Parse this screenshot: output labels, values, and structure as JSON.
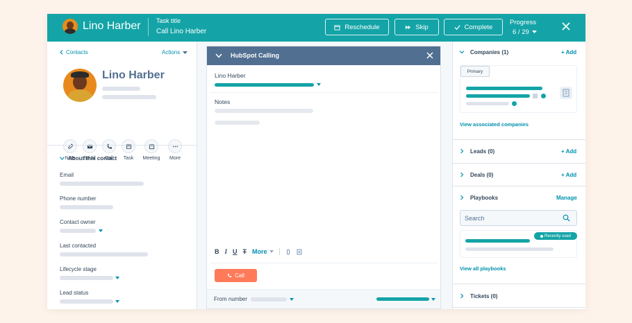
{
  "header": {
    "contact_name": "Lino Harber",
    "task_title_label": "Task title",
    "task_title_value": "Call Lino Harber",
    "reschedule_label": "Reschedule",
    "skip_label": "Skip",
    "complete_label": "Complete",
    "progress_label": "Progress",
    "progress_value": "6 / 29",
    "brand_color": "#14a4a7"
  },
  "left": {
    "back_label": "Contacts",
    "actions_label": "Actions",
    "contact_name": "Lino Harber",
    "actions": [
      {
        "label": "Note",
        "icon": "pencil-icon"
      },
      {
        "label": "Email",
        "icon": "envelope-icon"
      },
      {
        "label": "Call",
        "icon": "phone-icon"
      },
      {
        "label": "Task",
        "icon": "task-icon"
      },
      {
        "label": "Meeting",
        "icon": "calendar-icon"
      },
      {
        "label": "More",
        "icon": "ellipsis-icon"
      }
    ],
    "about_label": "About this contact",
    "fields": [
      "Email",
      "Phone number",
      "Contact owner",
      "Last contacted",
      "Lifecycle stage",
      "Lead status"
    ]
  },
  "middle": {
    "panel_title": "HubSpot Calling",
    "contact_name": "Lino Harber",
    "notes_label": "Notes",
    "format_tools": [
      "B",
      "I",
      "U",
      "T",
      "More"
    ],
    "call_button": "Call",
    "from_number_label": "From number",
    "call_button_color": "#ff7a59"
  },
  "right": {
    "companies_title": "Companies (1)",
    "add_label": "+ Add",
    "primary_badge": "Primary",
    "view_companies": "View associated companies",
    "leads_title": "Leads (0)",
    "deals_title": "Deals (0)",
    "playbooks_title": "Playbooks",
    "manage_label": "Manage",
    "search_placeholder": "Search",
    "recently_used": "Recently used",
    "view_playbooks": "View all playbooks",
    "tickets_title": "Tickets (0)"
  }
}
